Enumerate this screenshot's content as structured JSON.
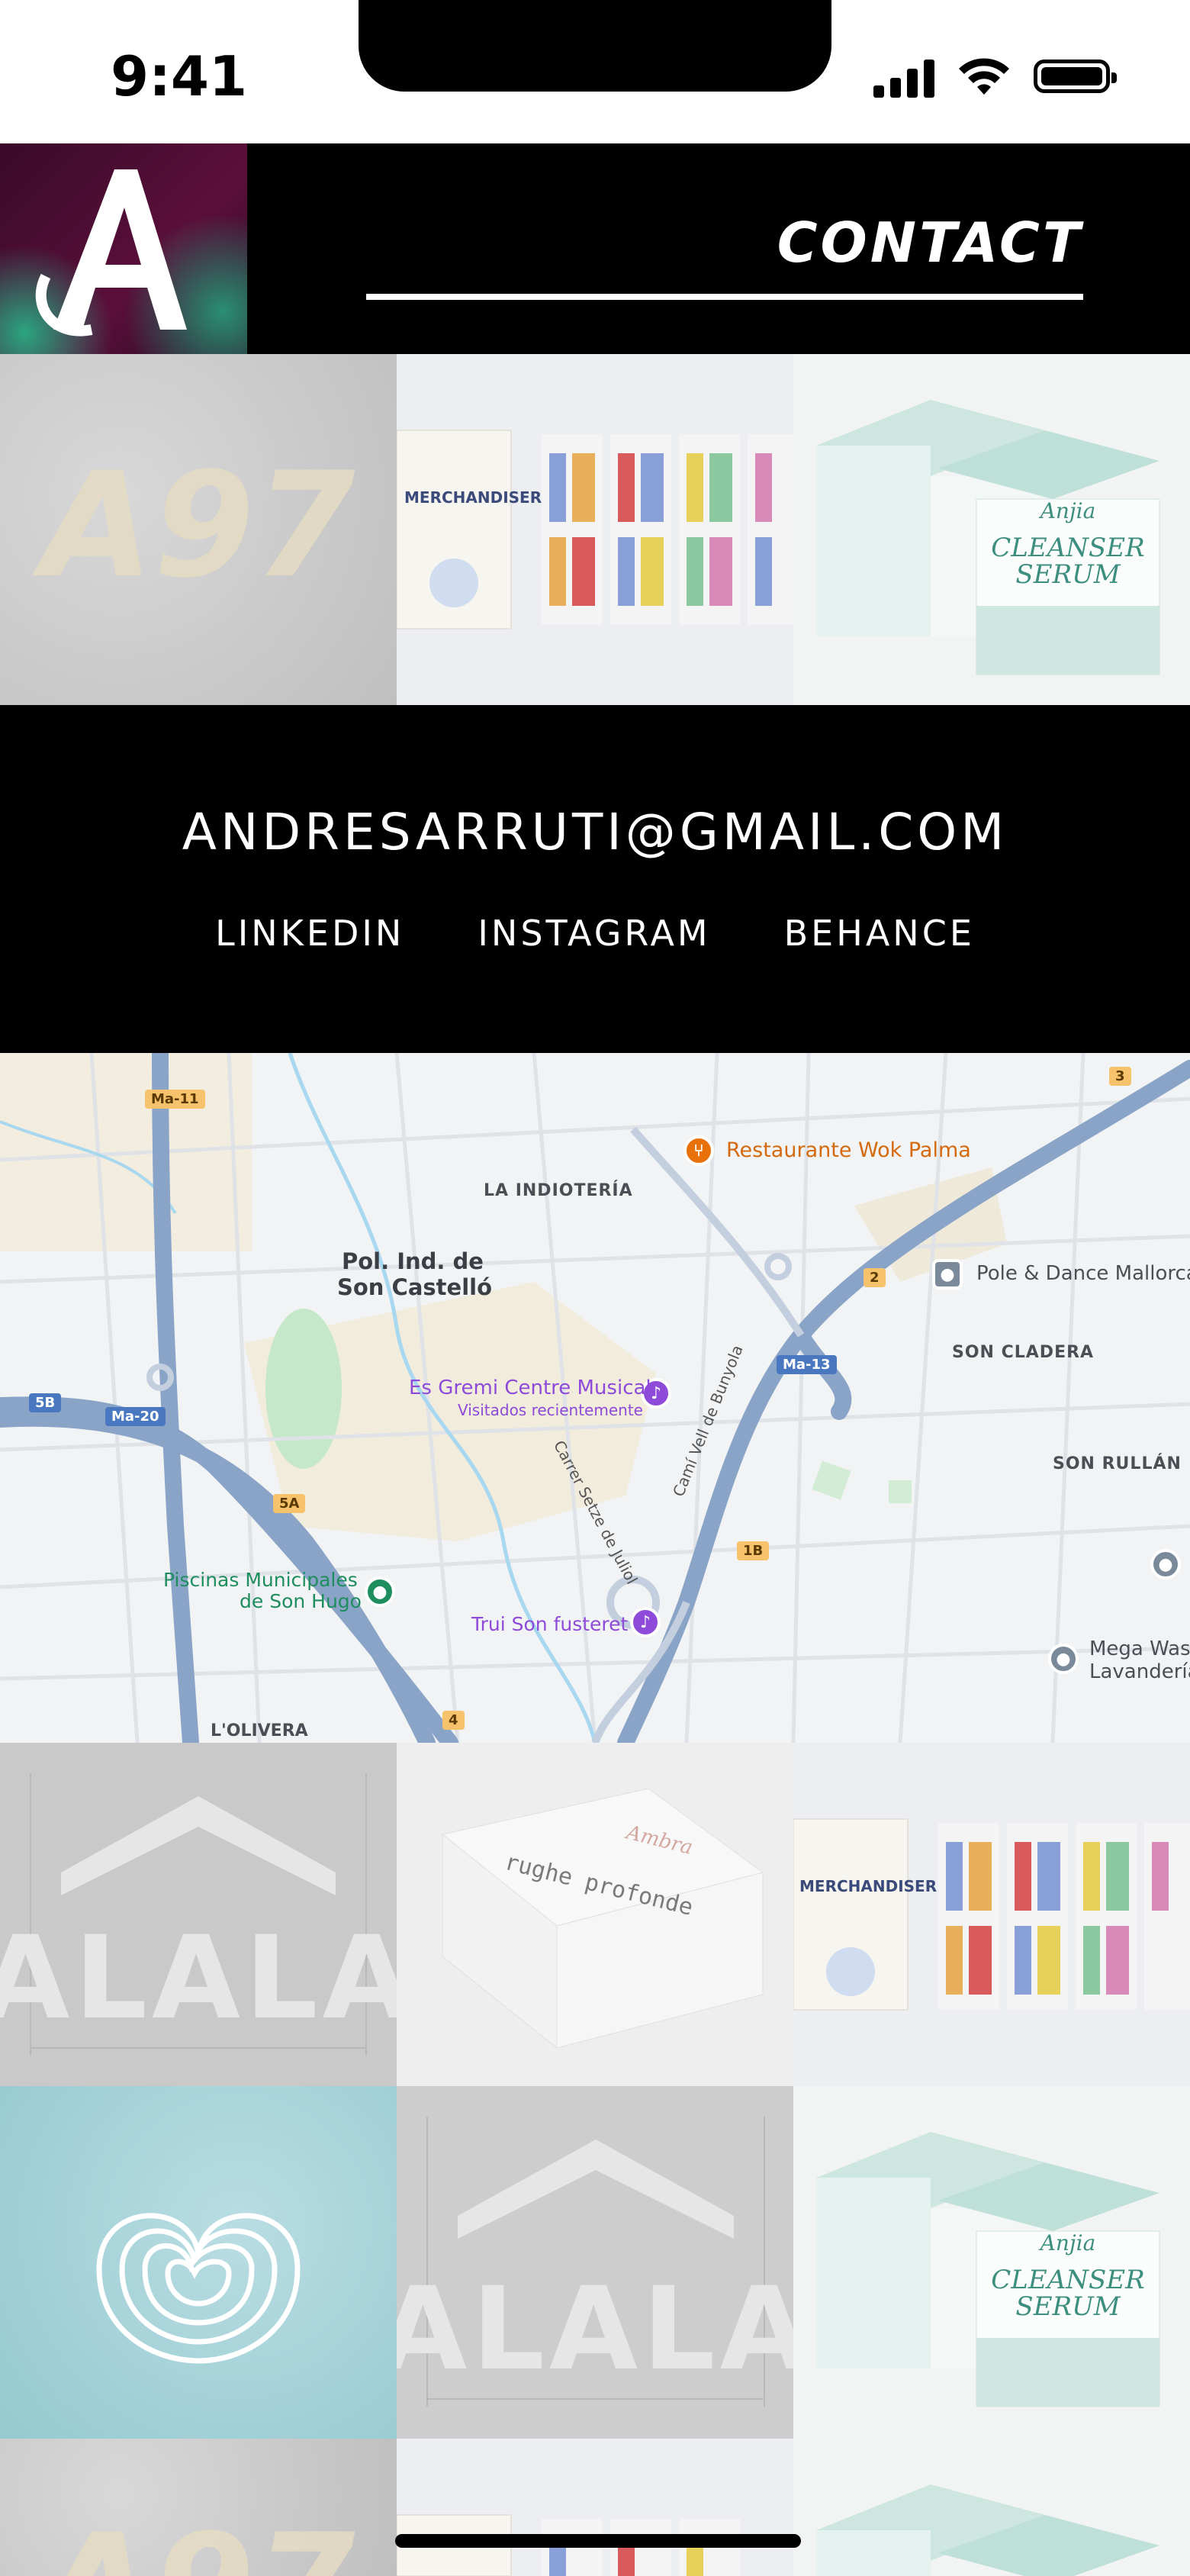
{
  "status_bar": {
    "time": "9:41"
  },
  "header": {
    "logo_letter": "A",
    "nav_link": "CONTACT"
  },
  "tiles": {
    "a97_text": "A97",
    "merch_title": "MERCHANDISER",
    "box_brand": "Anjia",
    "box_line1": "CLEANSER",
    "box_line2": "SERUM",
    "alala_text": "ALALA",
    "rughe_brand": "Ambra",
    "rughe_text": "rughe profonde"
  },
  "contact": {
    "email": "ANDRESARRUTI@GMAIL.COM",
    "socials": [
      "LINKEDIN",
      "INSTAGRAM",
      "BEHANCE"
    ]
  },
  "map": {
    "labels": {
      "restaurant": "Restaurante Wok Palma",
      "indioteria": "LA INDIOTERÍA",
      "pol_ind_1": "Pol. Ind. de",
      "pol_ind_2": "Son Castelló",
      "pole_dance": "Pole & Dance Mallorca",
      "son_cladera": "SON CLADERA",
      "gremi_1": "Es Gremi Centre Musical",
      "gremi_2": "Visitados recientemente",
      "son_rullan": "SON RULLÁN",
      "carrer_setze": "Carrer Setze de Juliol",
      "cami_vell": "Camí Vell de Bunyola",
      "piscinas_1": "Piscinas Municipales",
      "piscinas_2": "de Son Hugo",
      "trui": "Trui Son fusteret",
      "mega_wash_1": "Mega Wash",
      "mega_wash_2": "Lavandería",
      "olivera": "L'OLIVERA"
    },
    "shields": {
      "ma11": "Ma-11",
      "ma20": "Ma-20",
      "ma13": "Ma-13",
      "5b": "5B",
      "5a": "5A",
      "1b": "1B",
      "2": "2",
      "3": "3",
      "4": "4"
    },
    "colors": {
      "water": "#a8d7f0",
      "park": "#c4e8c8",
      "road": "#6b8cb6",
      "poi_orange": "#e8710a",
      "poi_purple": "#8e4ad8",
      "poi_green": "#1e8e5e"
    }
  },
  "icons": [
    "signal-icon",
    "wifi-icon",
    "battery-icon",
    "restaurant-icon",
    "music-icon",
    "dance-icon",
    "pool-icon",
    "laundry-icon"
  ]
}
